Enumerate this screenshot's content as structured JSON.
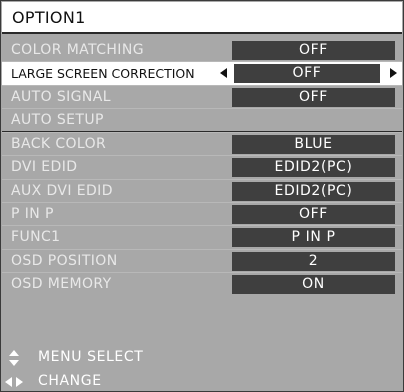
{
  "title": "OPTION1",
  "items": [
    {
      "label": "COLOR MATCHING",
      "value": "OFF"
    },
    {
      "label": "LARGE SCREEN CORRECTION",
      "value": "OFF"
    },
    {
      "label": "AUTO SIGNAL",
      "value": "OFF"
    },
    {
      "label": "AUTO SETUP",
      "value": ""
    },
    {
      "label": "BACK COLOR",
      "value": "BLUE"
    },
    {
      "label": "DVI EDID",
      "value": "EDID2(PC)"
    },
    {
      "label": "AUX DVI EDID",
      "value": "EDID2(PC)"
    },
    {
      "label": "P IN P",
      "value": "OFF"
    },
    {
      "label": "FUNC1",
      "value": "P IN P"
    },
    {
      "label": "OSD POSITION",
      "value": "2"
    },
    {
      "label": "OSD MEMORY",
      "value": "ON"
    }
  ],
  "footer": {
    "menu_select": "MENU SELECT",
    "change": "CHANGE"
  },
  "icons": {
    "up_down": "up-down-arrows-icon",
    "left_right": "left-right-arrows-icon"
  }
}
